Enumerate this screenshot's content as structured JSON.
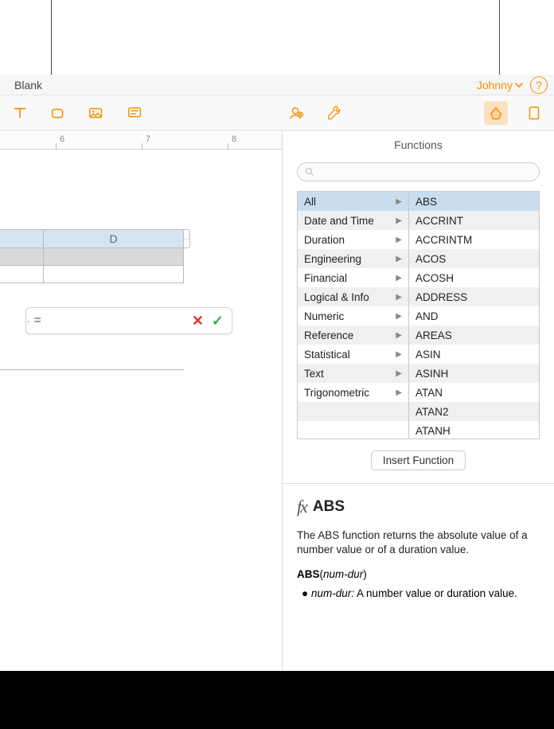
{
  "doc_title": "Blank",
  "user_name": "Johnny",
  "ruler": {
    "labels": [
      "6",
      "7",
      "8"
    ]
  },
  "formula_editor": {
    "symbol": "=",
    "value": "",
    "cancel": "✕",
    "accept": "✓"
  },
  "sidebar_title": "Functions",
  "categories": [
    "All",
    "Date and Time",
    "Duration",
    "Engineering",
    "Financial",
    "Logical & Info",
    "Numeric",
    "Reference",
    "Statistical",
    "Text",
    "Trigonometric"
  ],
  "category_selected": 0,
  "functions": [
    "ABS",
    "ACCRINT",
    "ACCRINTM",
    "ACOS",
    "ACOSH",
    "ADDRESS",
    "AND",
    "AREAS",
    "ASIN",
    "ASINH",
    "ATAN",
    "ATAN2",
    "ATANH"
  ],
  "function_selected": 0,
  "insert_btn": "Insert Function",
  "fx": {
    "symbol": "fx",
    "name": "ABS",
    "description": "The ABS function returns the absolute value of a number value or of a duration value.",
    "sig_name": "ABS",
    "sig_args": "num-dur",
    "params": [
      {
        "name": "num-dur",
        "desc": "A number value or duration value."
      }
    ]
  },
  "column_header": "D"
}
